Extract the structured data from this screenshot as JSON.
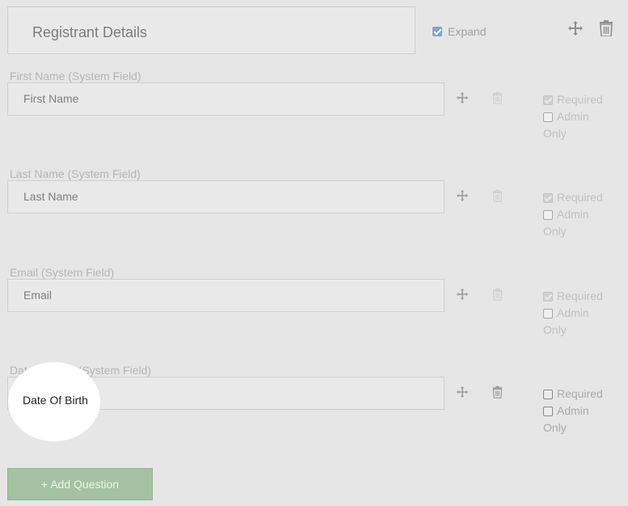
{
  "section": {
    "title": "Registrant Details",
    "expand_label": "Expand",
    "expand_checked": true
  },
  "fields": [
    {
      "label": "First Name (System Field)",
      "value": "First Name",
      "required_label": "Required",
      "admin_label": "Admin",
      "only_label": "Only"
    },
    {
      "label": "Last Name (System Field)",
      "value": "Last Name",
      "required_label": "Required",
      "admin_label": "Admin",
      "only_label": "Only"
    },
    {
      "label": "Email (System Field)",
      "value": "Email",
      "required_label": "Required",
      "admin_label": "Admin",
      "only_label": "Only"
    },
    {
      "label": "Date Of Birth (System Field)",
      "value": "Date Of Birth",
      "required_label": "Required",
      "admin_label": "Admin",
      "only_label": "Only"
    }
  ],
  "add_question_label": "+ Add Question",
  "colors": {
    "accent_checkbox": "#7da6d6",
    "add_button": "#a4c1a1",
    "background": "#e6e6e6"
  }
}
